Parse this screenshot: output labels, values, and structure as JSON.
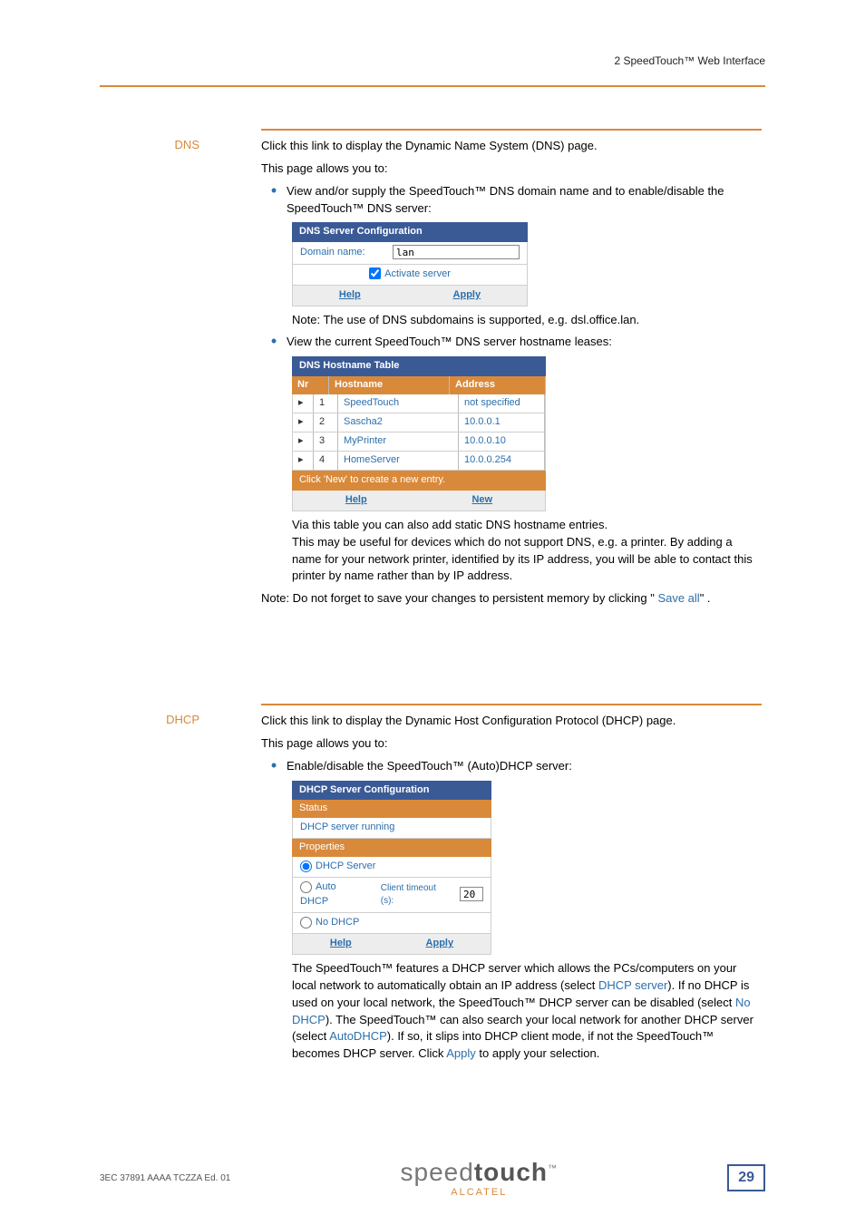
{
  "header": {
    "chapter": "2   SpeedTouch™ Web Interface"
  },
  "dns": {
    "label": "DNS",
    "intro1": "Click this link to display the Dynamic Name System (DNS) page.",
    "intro2": "This page allows you to:",
    "bullet1": "View and/or supply the SpeedTouch™ DNS domain name and to enable/disable the SpeedTouch™ DNS server:",
    "server_cfg": {
      "title": "DNS Server Configuration",
      "domain_label": "Domain name:",
      "domain_value": "lan",
      "activate_label": "Activate server",
      "help": "Help",
      "apply": "Apply"
    },
    "note1": "Note: The use of DNS subdomains is supported, e.g. dsl.office.lan.",
    "bullet2": "View the current SpeedTouch™ DNS server hostname leases:",
    "host_table": {
      "title": "DNS Hostname Table",
      "col_nr": "Nr",
      "col_host": "Hostname",
      "col_addr": "Address",
      "rows": [
        {
          "nr": "1",
          "host": "SpeedTouch",
          "addr": "not specified"
        },
        {
          "nr": "2",
          "host": "Sascha2",
          "addr": "10.0.0.1"
        },
        {
          "nr": "3",
          "host": "MyPrinter",
          "addr": "10.0.0.10"
        },
        {
          "nr": "4",
          "host": "HomeServer",
          "addr": "10.0.0.254"
        }
      ],
      "hint": "Click 'New' to create a new entry.",
      "help": "Help",
      "new": "New"
    },
    "after_table": "Via this table you can also add static DNS hostname entries.",
    "after_table2": "This may be useful for devices which do not support DNS, e.g. a printer. By adding a name for your network printer, identified by its IP address, you will be able to contact this printer by name rather than by IP address.",
    "note2_pre": "Note: Do not forget to save your changes to persistent memory by clicking \" ",
    "note2_link": "Save all",
    "note2_post": "\" ."
  },
  "dhcp": {
    "label": "DHCP",
    "intro1": "Click this link to display the Dynamic Host Configuration Protocol (DHCP) page.",
    "intro2": "This page allows you to:",
    "bullet1": "Enable/disable the SpeedTouch™ (Auto)DHCP server:",
    "server_cfg": {
      "title": "DHCP Server Configuration",
      "status_hdr": "Status",
      "status_val": "DHCP server running",
      "props_hdr": "Properties",
      "opt_server": "DHCP Server",
      "opt_auto": "Auto DHCP",
      "timeout_label": "Client timeout (s):",
      "timeout_value": "20",
      "opt_none": "No DHCP",
      "help": "Help",
      "apply": "Apply"
    },
    "para_pre": "The SpeedTouch™ features a DHCP server which allows the PCs/computers on your local network to automatically obtain an IP address (select ",
    "link_server": "DHCP server",
    "para_mid1": "). If no DHCP is used on your local network, the SpeedTouch™ DHCP server can be disabled (select ",
    "link_nodhcp": "No DHCP",
    "para_mid2": "). The SpeedTouch™ can also search your local network for another DHCP server (select ",
    "link_auto": "AutoDHCP",
    "para_mid3": "). If so, it slips into DHCP client mode, if not the SpeedTouch™ becomes DHCP server. Click ",
    "link_apply": "Apply",
    "para_post": " to apply your selection."
  },
  "footer": {
    "doc_id": "3EC 37891 AAAA TCZZA Ed. 01",
    "logo1": "speed",
    "logo1b": "touch",
    "logo_tm": "™",
    "logo2": "ALCATEL",
    "page": "29"
  }
}
